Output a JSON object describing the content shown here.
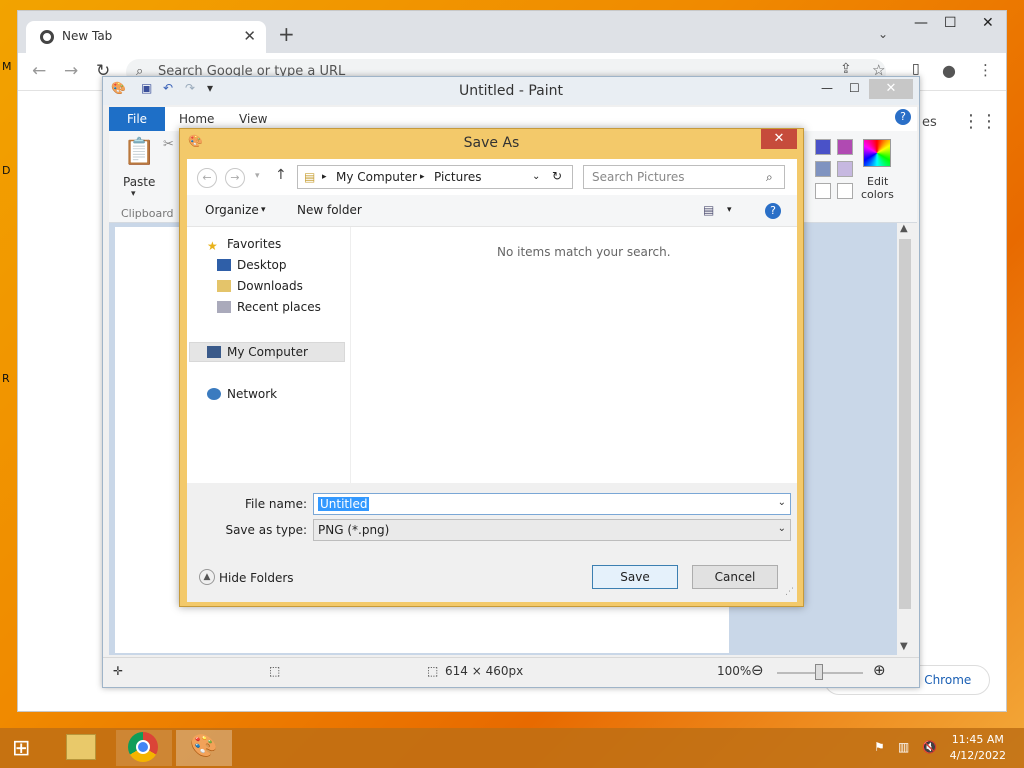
{
  "desktop": {
    "edge_chars": [
      "M",
      "D",
      "R"
    ]
  },
  "chrome": {
    "tab_title": "New Tab",
    "tab_close": "✕",
    "new_tab": "+",
    "omnibox_placeholder": "Search Google or type a URL",
    "apps_partial": "es",
    "bottom_partial": "e Chrome",
    "min": "—",
    "max": "☐",
    "close": "✕"
  },
  "paint": {
    "title": "Untitled - Paint",
    "tabs": {
      "file": "File",
      "home": "Home",
      "view": "View"
    },
    "paste_label": "Paste",
    "clipboard_label": "Clipboard",
    "edit_colors_label_1": "Edit",
    "edit_colors_label_2": "colors",
    "status_size": "614 × 460px",
    "zoom": "100%",
    "help_glyph": "?",
    "swatches": [
      "#4a52c8",
      "#b04ab2",
      "#7f93c0",
      "#c6b8e0",
      "#ffffff",
      "#ffffff"
    ]
  },
  "dialog": {
    "title": "Save As",
    "breadcrumb": [
      "My Computer",
      "Pictures"
    ],
    "search_placeholder": "Search Pictures",
    "organize": "Organize",
    "new_folder": "New folder",
    "nav": {
      "favorites": "Favorites",
      "desktop": "Desktop",
      "downloads": "Downloads",
      "recent": "Recent places",
      "computer": "My Computer",
      "network": "Network"
    },
    "empty_message": "No items match your search.",
    "file_name_label": "File name:",
    "file_name_value": "Untitled",
    "type_label": "Save as type:",
    "type_value": "PNG (*.png)",
    "hide_folders": "Hide Folders",
    "save": "Save",
    "cancel": "Cancel"
  },
  "taskbar": {
    "time": "11:45 AM",
    "date": "4/12/2022"
  }
}
